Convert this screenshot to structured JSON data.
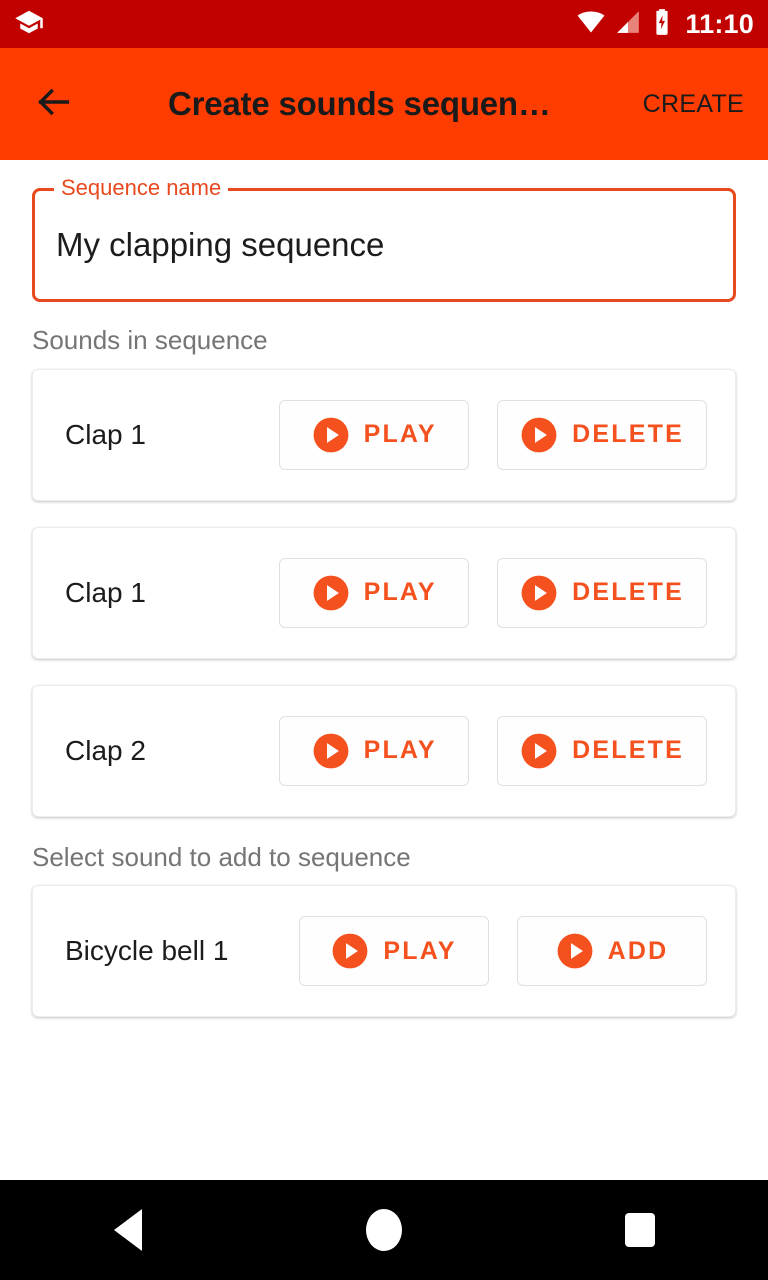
{
  "status_bar": {
    "app_icon": "graduation-cap-icon",
    "wifi_icon": "wifi-icon",
    "signal_icon": "cellular-signal-icon",
    "battery_icon": "battery-charging-icon",
    "clock": "11:10",
    "background_color": "#c10000",
    "foreground_color": "#ffffff"
  },
  "app_bar": {
    "back_icon": "arrow-left-icon",
    "title": "Create sounds sequen…",
    "action_label": "CREATE",
    "background_color": "#ff3d00",
    "text_color": "#1a1a1a"
  },
  "name_field": {
    "label": "Sequence name",
    "value": "My clapping sequence",
    "placeholder": "Sequence name",
    "border_color": "#e8491f",
    "label_color": "#e8491f"
  },
  "sequence_section": {
    "label": "Sounds in sequence",
    "items": [
      {
        "title": "Clap 1",
        "play_label": "PLAY",
        "play_icon": "play-circle-icon",
        "secondary_label": "DELETE",
        "secondary_icon": "play-circle-icon"
      },
      {
        "title": "Clap 1",
        "play_label": "PLAY",
        "play_icon": "play-circle-icon",
        "secondary_label": "DELETE",
        "secondary_icon": "play-circle-icon"
      },
      {
        "title": "Clap 2",
        "play_label": "PLAY",
        "play_icon": "play-circle-icon",
        "secondary_label": "DELETE",
        "secondary_icon": "play-circle-icon"
      }
    ]
  },
  "available_section": {
    "label": "Select sound to add to sequence",
    "items": [
      {
        "title": "Bicycle bell 1",
        "play_label": "PLAY",
        "play_icon": "play-circle-icon",
        "secondary_label": "ADD",
        "secondary_icon": "play-circle-icon"
      }
    ]
  },
  "nav_bar": {
    "back_icon": "nav-back-triangle-icon",
    "home_icon": "nav-home-circle-icon",
    "recents_icon": "nav-recents-square-icon",
    "background_color": "#000000"
  },
  "theme": {
    "accent": "#f4511e",
    "primary": "#ff3d00",
    "primary_dark": "#c10000",
    "muted_text": "#757575",
    "body_text": "#1c1c1c"
  }
}
